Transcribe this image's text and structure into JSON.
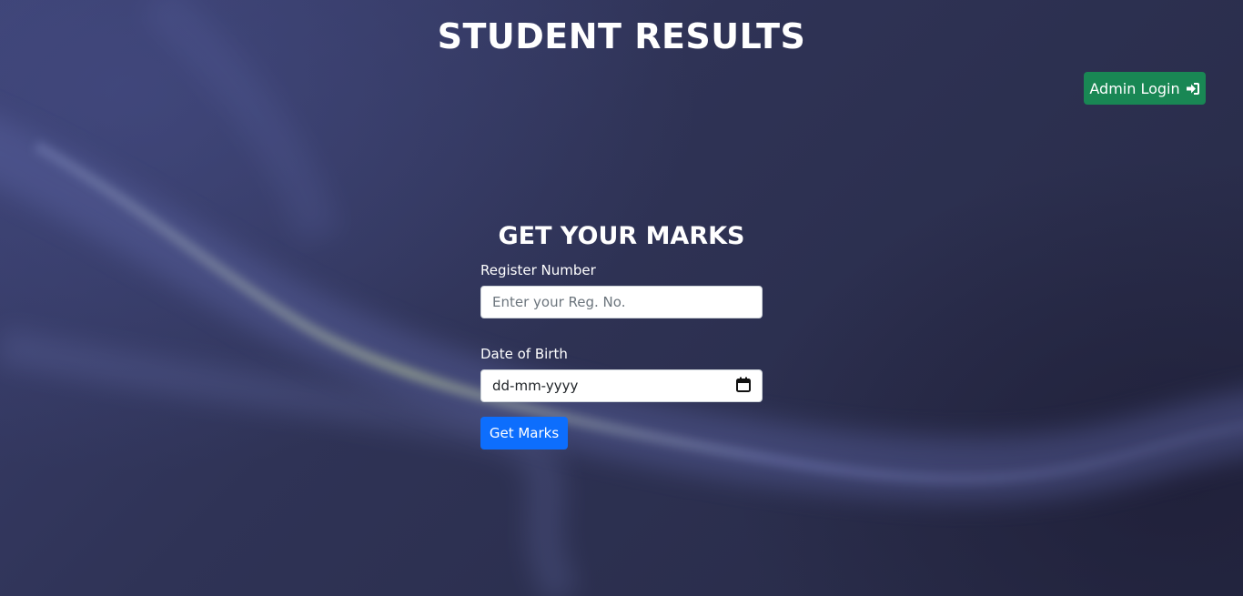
{
  "header": {
    "title": "STUDENT RESULTS"
  },
  "admin": {
    "label": "Admin Login",
    "icon": "sign-in-icon",
    "color": "#198754"
  },
  "form": {
    "heading": "GET YOUR MARKS",
    "reg_label": "Register Number",
    "reg_placeholder": "Enter your Reg. No.",
    "reg_value": "",
    "dob_label": "Date of Birth",
    "dob_value": "dd-mm-yyyy",
    "dob_icon": "calendar-icon",
    "submit_label": "Get Marks",
    "submit_color": "#0d6efd"
  }
}
